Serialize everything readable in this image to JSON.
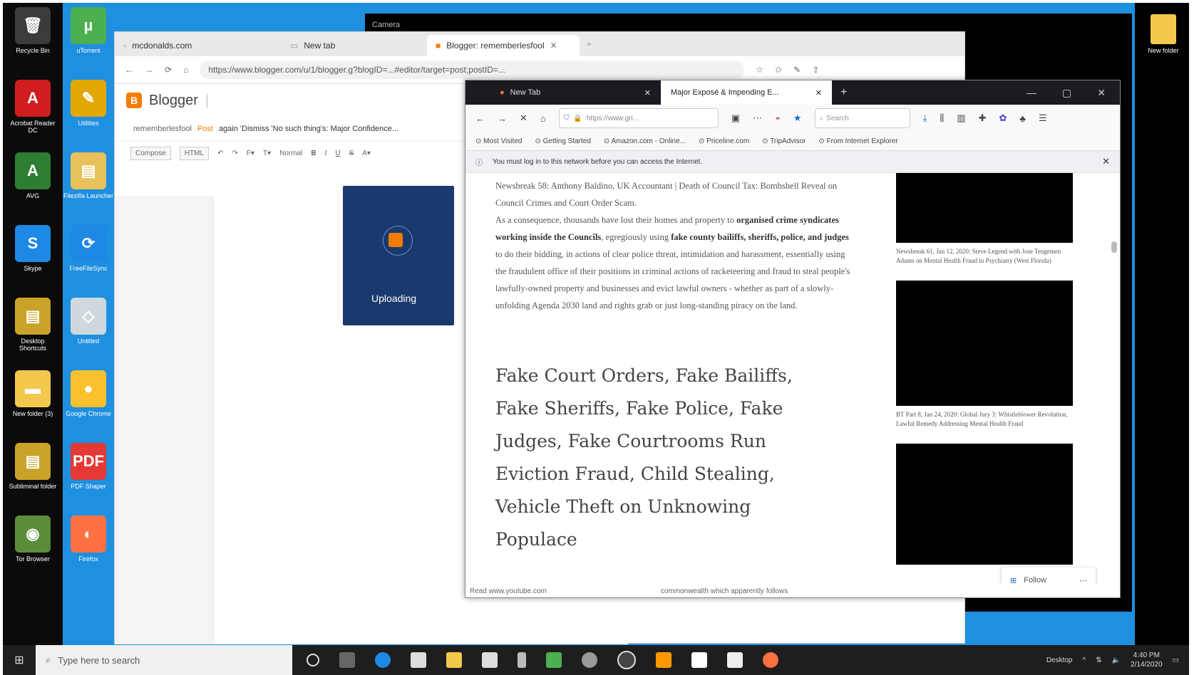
{
  "desktop": {
    "icons_col1": [
      {
        "label": "Recycle Bin",
        "glyph": "🗑",
        "color": "#3b3b3b"
      },
      {
        "label": "Acrobat Reader DC",
        "glyph": "A",
        "color": "#d01e1e"
      },
      {
        "label": "AVG",
        "glyph": "A",
        "color": "#2e7d32"
      },
      {
        "label": "Skype",
        "glyph": "S",
        "color": "#1e88e5"
      },
      {
        "label": "Desktop Shortcuts",
        "glyph": "▤",
        "color": "#c9a227"
      },
      {
        "label": "New folder (3)",
        "glyph": "▬",
        "color": "#f2c94c"
      },
      {
        "label": "Subliminal folder",
        "glyph": "▤",
        "color": "#c9a227"
      },
      {
        "label": "Tor Browser",
        "glyph": "◉",
        "color": "#5b8c3a"
      }
    ],
    "icons_col2": [
      {
        "label": "uTorrent",
        "glyph": "µ",
        "color": "#4caf50"
      },
      {
        "label": "Utilities",
        "glyph": "✎",
        "color": "#e0a800"
      },
      {
        "label": "Filezilla Launcher",
        "glyph": "▤",
        "color": "#e8c15a"
      },
      {
        "label": "FreeFileSync",
        "glyph": "⟳",
        "color": "#1e88e5"
      },
      {
        "label": "Untitled",
        "glyph": "◇",
        "color": "#cfd8dc"
      },
      {
        "label": "Google Chrome",
        "glyph": "●",
        "color": "#fbc02d"
      },
      {
        "label": "PDF Shaper",
        "glyph": "PDF",
        "color": "#e53935"
      },
      {
        "label": "Firefox",
        "glyph": "◐",
        "color": "#ff7043"
      }
    ],
    "camera_title": "Camera",
    "new_folder_label": "New folder"
  },
  "edge": {
    "tabs": [
      "mcdonalds.com",
      "New tab",
      "Blogger: rememberlesfool"
    ],
    "url": "https://www.blogger.com/u/1/blogger.g?blogID=...#editor/target=post;postID=...",
    "blogger_label": "Blogger",
    "breadcrumb": {
      "blog": "rememberlesfool",
      "sep": "Post",
      "title": "again 'Dismiss 'No such thing's: Major Confidence..."
    },
    "toolbar": {
      "compose": "Compose",
      "html": "HTML",
      "format": "Normal"
    },
    "upload": {
      "text": "Uploading"
    }
  },
  "firefox": {
    "tabs": [
      {
        "label": "New Tab"
      },
      {
        "label": "Major Exposé & Impending E..."
      }
    ],
    "url": "https://www.gri...",
    "search_placeholder": "Search",
    "bookmarks": [
      "Most Visited",
      "Getting Started",
      "Amazon.com - Online...",
      "Priceline.com",
      "TripAdvisor",
      "From Internet Explorer"
    ],
    "notice": "You must log in to this network before you can access the Internet.",
    "article_html_parts": {
      "p1": "Newsbreak 58: Anthony Baldino, UK Accountant | Death of Council Tax: Bombshell Reveal on Council Crimes and Court Order Scam.",
      "p2_start": "As a consequence, thousands have lost their homes and property to ",
      "p2_b1": "organised crime syndicates working inside the Councils",
      "p2_mid": ", egregiously using ",
      "p2_b2": "fake county bailiffs, sheriffs, police, and judges",
      "p2_end": " to do their bidding, in actions of clear police threat, intimidation and harassment, essentially using the fraudulent office of their positions in criminal actions of racketeering and fraud to steal people's lawfully-owned property and businesses and evict lawful owners - whether as part of a slowly-unfolding Agenda 2030 land and rights grab or just long-standing piracy on the land."
    },
    "heading": "Fake Court Orders, Fake Bailiffs, Fake Sheriffs, Fake Police, Fake Judges, Fake Courtrooms Run Eviction Fraud, Child Stealing, Vehicle Theft on Unknowing Populace",
    "sidebar_captions": [
      "Newsbreak 61, Jan 12, 2020: Steve Legend with Jose Tengemen Adams on Mental Health Fraud in Psychiatry (West Florida)",
      "BT Part 8, Jan 24, 2020: Global Jury 3: Whistleblower Revolution, Lawful Remedy Addressing Mental Health Fraud"
    ],
    "status_left": "Read www.youtube.com",
    "status_right": "commonwealth which apparently follows",
    "follow_label": "Follow"
  },
  "taskbar": {
    "search_placeholder": "Type here to search",
    "desktop_label": "Desktop",
    "time": "4:40 PM",
    "date": "2/14/2020"
  }
}
